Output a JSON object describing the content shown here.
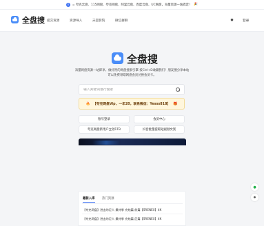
{
  "announcement": {
    "text": "= 夸克云盘、115网盘、夸克网盘、阿里云盘、百度云盘、UC网盘，海量资源一站搞定！",
    "info_icon": "info-icon",
    "bell_icon": "party-icon"
  },
  "header": {
    "brand": "全盘搜",
    "nav": [
      "提交资源",
      "资源导入",
      "天空影院",
      "微信群聊"
    ],
    "theme_icon": "sun-icon",
    "login": "登录"
  },
  "hero": {
    "title": "全盘搜",
    "description": "海量网盘资源一站即享，做好用的网盘搜索引擎 按Ctrl+D收藏我们！朋友圈分享本站可以免费领取网盘会员兑换会员卡。"
  },
  "search": {
    "placeholder": "输入关键词进行搜索",
    "value": ""
  },
  "promo": {
    "text": "【夸克网盘Vip，一年20，联系微信：Yesss818】",
    "left_icon": "fire-icon",
    "right_icon": "gift-icon"
  },
  "buttons": [
    "账号登录",
    "会员中心",
    "夸克网盘新用户立领1TB",
    "抖音批量提取短视频文案"
  ],
  "list": {
    "tabs": [
      "最新入库",
      "热门资源"
    ],
    "rows": [
      "【夸克网盘】进击的巨人 最终季 完结篇 前篇【SRENEX】4K",
      "【夸克网盘】进击的巨人 最终季 完结篇 后篇【SRENEX】4K"
    ]
  },
  "colors": {
    "accent": "#3a6ff2",
    "brand": "#4a8df8",
    "promo_bg": "#fff6dc"
  }
}
